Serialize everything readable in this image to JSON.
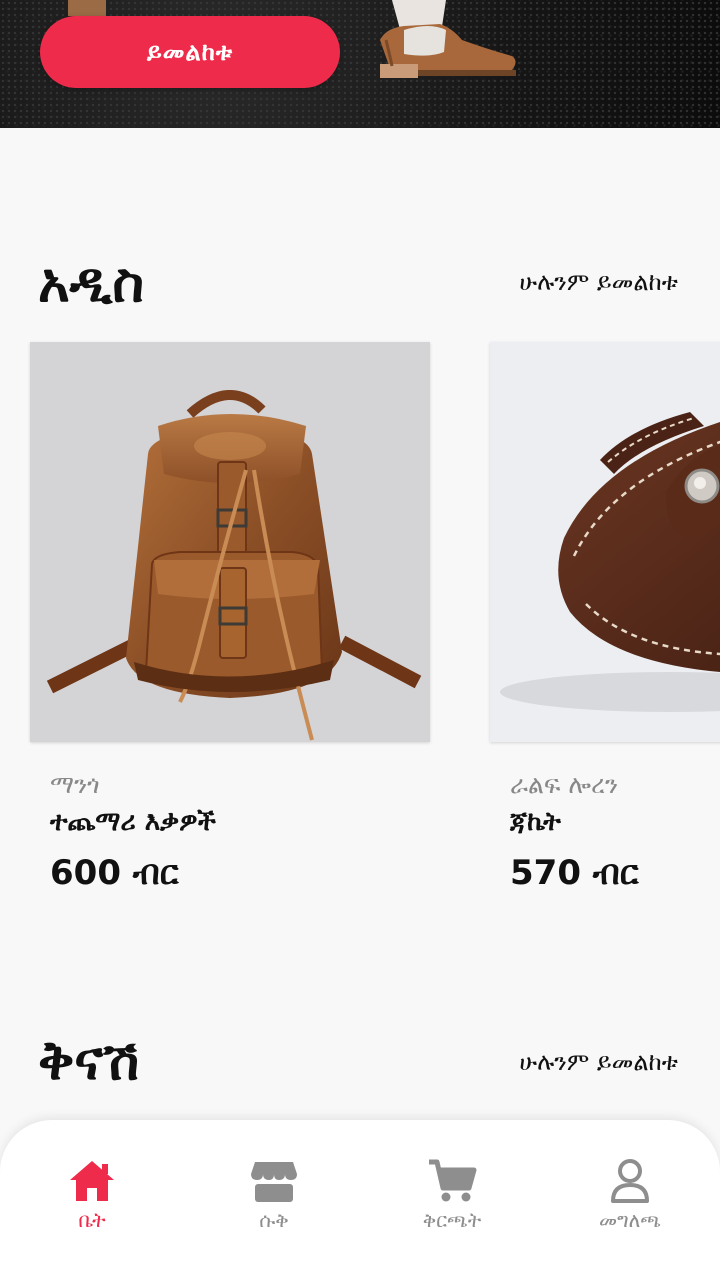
{
  "hero": {
    "button_label": "ይመልከቱ"
  },
  "sections": [
    {
      "title": "አዲስ",
      "view_all": "ሁሉንም ይመልከቱ"
    },
    {
      "title": "ቅናሽ",
      "view_all": "ሁሉንም ይመልከቱ"
    }
  ],
  "products": [
    {
      "brand": "ማንጎ",
      "name": "ተጨማሪ እቃዎች",
      "price": "600 ብር",
      "image_icon": "leather-backpack"
    },
    {
      "brand": "ራልፍ ሎረን",
      "name": "ጃኬት",
      "price": "570 ብር",
      "image_icon": "leather-pouch"
    }
  ],
  "nav": {
    "active": "home",
    "items": [
      {
        "id": "home",
        "label": "ቤት",
        "icon": "home-icon"
      },
      {
        "id": "shop",
        "label": "ሱቅ",
        "icon": "store-icon"
      },
      {
        "id": "cart",
        "label": "ቅርጫት",
        "icon": "cart-icon"
      },
      {
        "id": "profile",
        "label": "መግለጫ",
        "icon": "user-icon"
      }
    ]
  },
  "colors": {
    "accent": "#ee2b4a",
    "inactive": "#8e8e8e",
    "background": "#f8f8f8"
  }
}
